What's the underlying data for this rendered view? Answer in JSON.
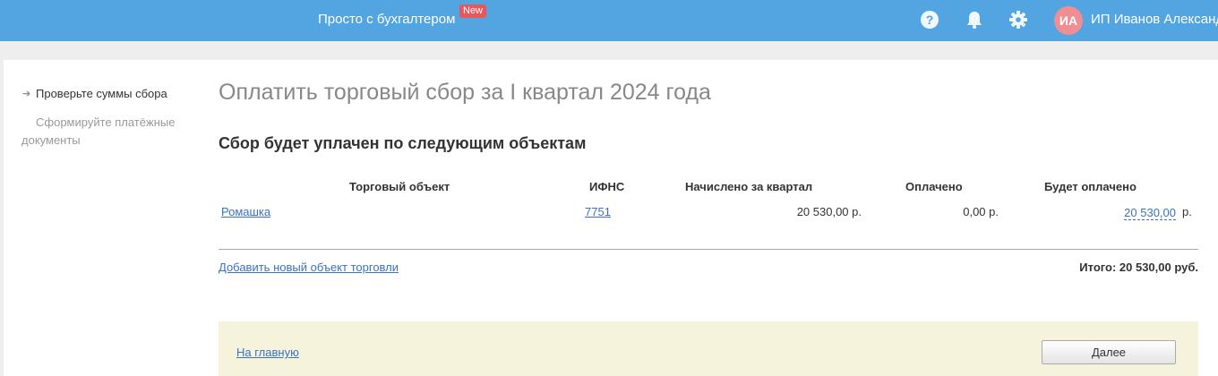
{
  "header": {
    "brand": "Просто с бухгалтером",
    "badge": "New",
    "icons": [
      "help-icon",
      "bell-icon",
      "gear-icon"
    ],
    "avatar_initials": "ИА",
    "user_name": "ИП Иванов Александр"
  },
  "steps": [
    {
      "label": "Проверьте суммы сбора",
      "active": true
    },
    {
      "label": "Сформируйте платёжные документы",
      "active": false
    }
  ],
  "page": {
    "title": "Оплатить торговый сбор за I квартал 2024 года",
    "section_title": "Сбор будет уплачен по следующим объектам"
  },
  "table": {
    "headers": [
      "Торговый объект",
      "ИФНС",
      "Начислено за квартал",
      "Оплачено",
      "Будет оплачено"
    ],
    "rows": [
      {
        "object": "Ромашка",
        "ifns": "7751",
        "charged": "20 530,00 р.",
        "paid": "0,00 р.",
        "to_pay": "20 530,00",
        "currency": "р."
      }
    ]
  },
  "add_object_link": "Добавить новый объект торговли",
  "total": "Итого: 20 530,00 руб.",
  "footer": {
    "home_link": "На главную",
    "next_button": "Далее"
  },
  "colors": {
    "header_bg": "#52a5e0",
    "badge_bg": "#e8585a",
    "avatar_bg": "#ef8e93",
    "link": "#3a72c0",
    "footer_bg": "#f5f3dc"
  }
}
